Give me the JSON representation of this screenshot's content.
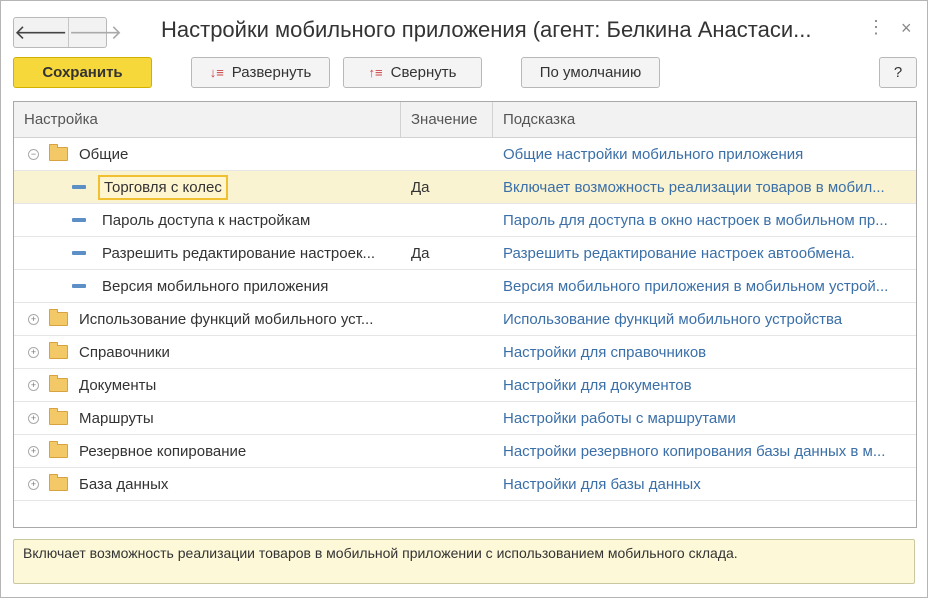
{
  "window": {
    "title": "Настройки мобильного приложения (агент: Белкина Анастаси...",
    "back": "🡐",
    "forward": "🡒",
    "more": "⋮",
    "close": "×"
  },
  "toolbar": {
    "save_label": "Сохранить",
    "expand_label": "Развернуть",
    "collapse_label": "Свернуть",
    "default_label": "По умолчанию",
    "help_label": "?"
  },
  "grid": {
    "columns": [
      "Настройка",
      "Значение",
      "Подсказка"
    ],
    "rows": [
      {
        "type": "group",
        "expanded": true,
        "name": "Общие",
        "value": "",
        "hint": "Общие настройки мобильного приложения"
      },
      {
        "type": "leaf",
        "selected": true,
        "name": "Торговля с колес",
        "value": "Да",
        "hint": "Включает возможность реализации товаров в мобил..."
      },
      {
        "type": "leaf",
        "name": "Пароль доступа к настройкам",
        "value": "",
        "hint": "Пароль для доступа в окно настроек в мобильном пр..."
      },
      {
        "type": "leaf",
        "name": "Разрешить редактирование настроек...",
        "value": "Да",
        "hint": "Разрешить редактирование настроек автообмена."
      },
      {
        "type": "leaf",
        "name": "Версия мобильного приложения",
        "value": "",
        "hint": "Версия мобильного приложения в мобильном устрой..."
      },
      {
        "type": "group",
        "expanded": false,
        "name": "Использование функций мобильного уст...",
        "value": "",
        "hint": "Использование функций мобильного устройства"
      },
      {
        "type": "group",
        "expanded": false,
        "name": "Справочники",
        "value": "",
        "hint": "Настройки для справочников"
      },
      {
        "type": "group",
        "expanded": false,
        "name": "Документы",
        "value": "",
        "hint": "Настройки для документов"
      },
      {
        "type": "group",
        "expanded": false,
        "name": "Маршруты",
        "value": "",
        "hint": "Настройки работы с маршрутами"
      },
      {
        "type": "group",
        "expanded": false,
        "name": "Резервное копирование",
        "value": "",
        "hint": "Настройки резервного копирования базы данных в м..."
      },
      {
        "type": "group",
        "expanded": false,
        "name": "База данных",
        "value": "",
        "hint": "Настройки для базы данных"
      }
    ]
  },
  "hint_panel": {
    "text": "Включает возможность реализации товаров в мобильной приложении с использованием мобильного склада."
  }
}
